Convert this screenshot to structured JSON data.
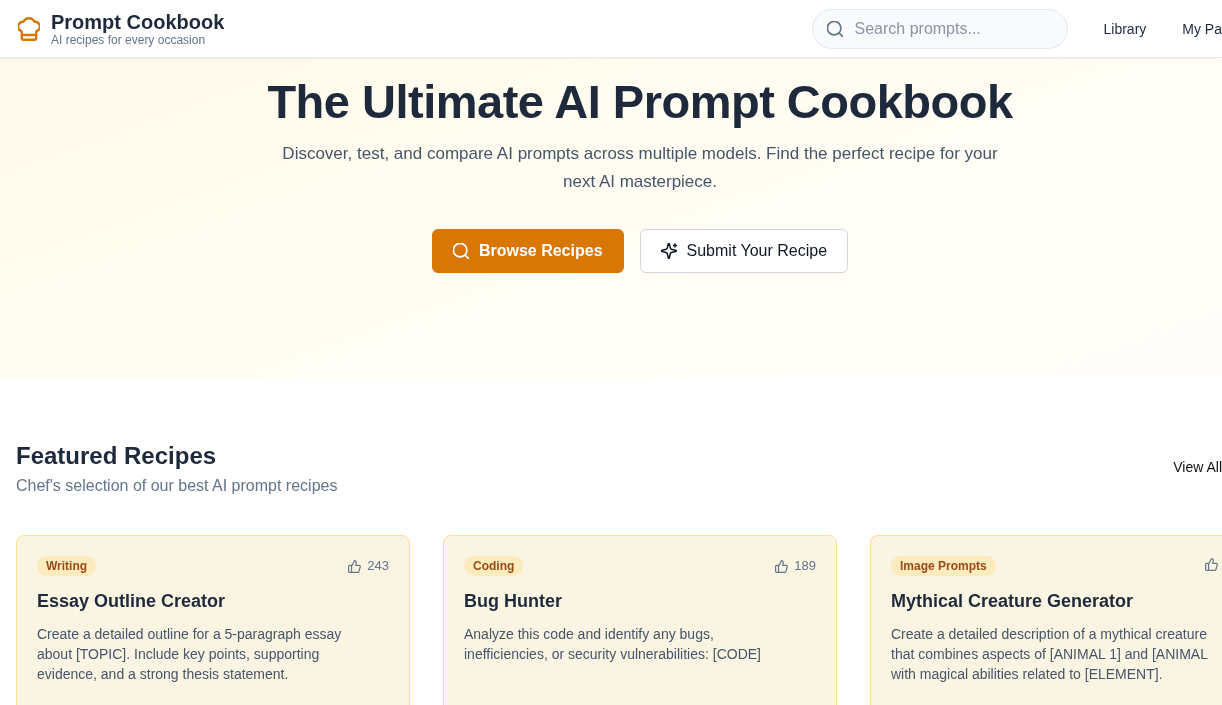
{
  "header": {
    "logo": {
      "title": "Prompt Cookbook",
      "tagline": "AI recipes for every occasion"
    },
    "search": {
      "placeholder": "Search prompts..."
    },
    "nav": [
      "Library",
      "My Pa"
    ]
  },
  "hero": {
    "title": "The Ultimate AI Prompt Cookbook",
    "subtitle": "Discover, test, and compare AI prompts across multiple models. Find the perfect recipe for your next AI masterpiece.",
    "buttons": [
      {
        "label": "Browse Recipes",
        "kind": "primary"
      },
      {
        "label": "Submit Your Recipe",
        "kind": "secondary"
      }
    ]
  },
  "featured": {
    "title": "Featured Recipes",
    "subtitle": "Chef's selection of our best AI prompt recipes",
    "view_all": "View All",
    "recipes": [
      {
        "category": "Writing",
        "likes": "243",
        "title": "Essay Outline Creator",
        "description_lines": [
          "Create a detailed outline for a 5-paragraph essay",
          "about [TOPIC]. Include key points, supporting",
          "evidence, and a strong thesis statement."
        ]
      },
      {
        "category": "Coding",
        "likes": "189",
        "title": "Bug Hunter",
        "description_lines": [
          "Analyze this code and identify any bugs,",
          "inefficiencies, or security vulnerabilities: [CODE]"
        ]
      },
      {
        "category": "Image Prompts",
        "title": "Mythical Creature Generator",
        "description_lines": [
          "Create a detailed description of a mythical creature",
          "that combines aspects of [ANIMAL 1] and [ANIMAL",
          "with magical abilities related to [ELEMENT]."
        ]
      }
    ]
  }
}
